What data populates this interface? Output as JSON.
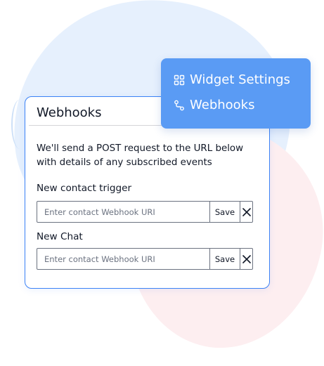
{
  "menu": {
    "items": [
      {
        "label": "Widget Settings",
        "icon": "grid-icon"
      },
      {
        "label": "Webhooks",
        "icon": "route-icon"
      }
    ],
    "background": "#5a9bf4"
  },
  "card": {
    "title": "Webhooks",
    "description": "We'll send a POST request to the URL below with details of any subscribed events",
    "sections": [
      {
        "label": "New contact trigger",
        "placeholder": "Enter contact Webhook URI",
        "value": "",
        "save_label": "Save",
        "clear_icon": "close-icon"
      },
      {
        "label": "New Chat",
        "placeholder": "Enter contact Webhook URI",
        "value": "",
        "save_label": "Save",
        "clear_icon": "close-icon"
      }
    ],
    "border_color": "#3b82f6"
  }
}
